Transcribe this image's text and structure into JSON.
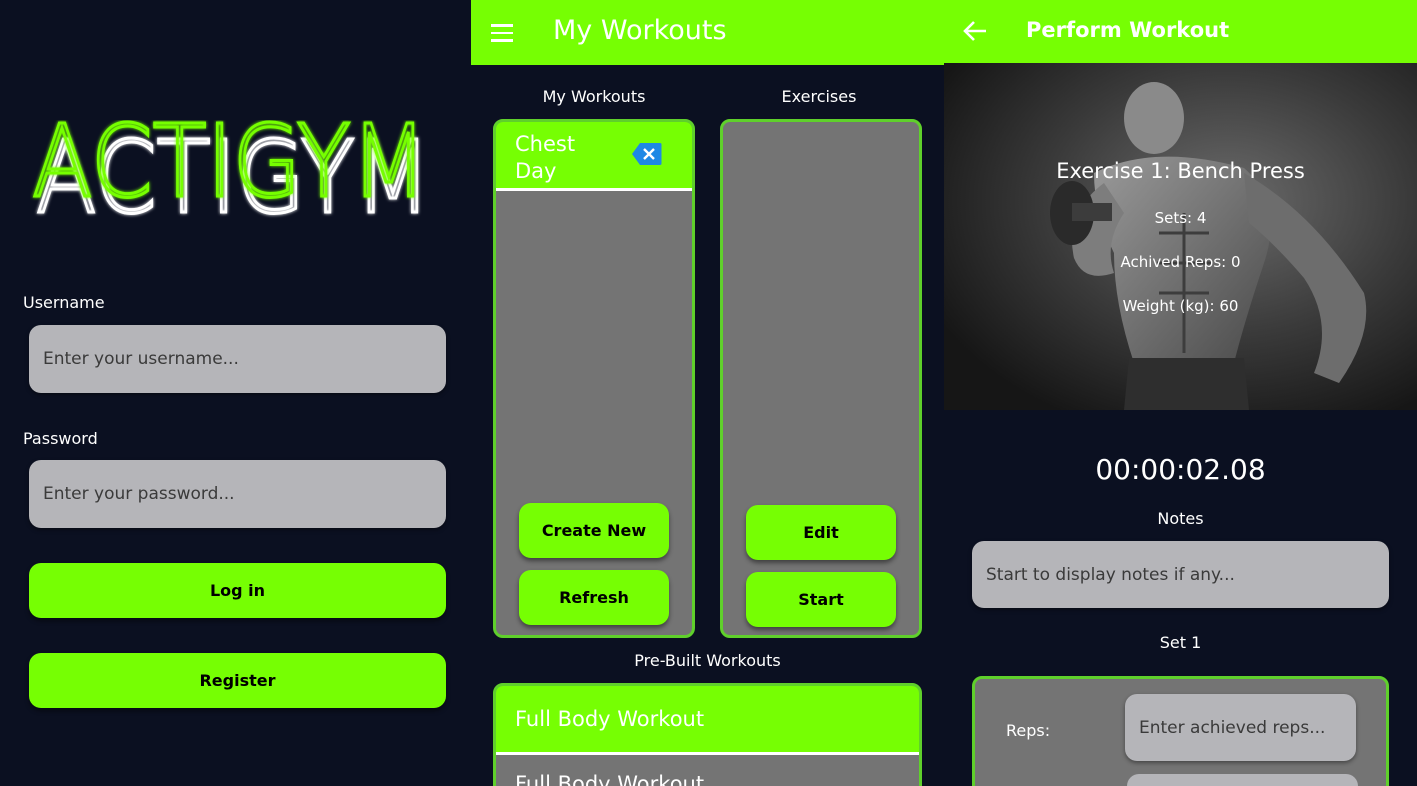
{
  "login": {
    "logo_text": "ACTIGYM",
    "username_label": "Username",
    "username_placeholder": "Enter your username...",
    "password_label": "Password",
    "password_placeholder": "Enter your password...",
    "login_button": "Log in",
    "register_button": "Register"
  },
  "workouts": {
    "title": "My Workouts",
    "my_workouts_label": "My Workouts",
    "exercises_label": "Exercises",
    "items": [
      {
        "name": "Chest\nDay"
      }
    ],
    "create_button": "Create New",
    "refresh_button": "Refresh",
    "edit_button": "Edit",
    "start_button": "Start",
    "prebuilt_label": "Pre-Built Workouts",
    "prebuilt": [
      {
        "name": "Full Body Workout"
      },
      {
        "name": "Full Body Workout"
      }
    ]
  },
  "perform": {
    "title": "Perform Workout",
    "exercise": "Exercise 1: Bench Press",
    "sets": "Sets: 4",
    "achieved_reps": "Achived Reps: 0",
    "weight": "Weight (kg): 60",
    "timer": "00:00:02.08",
    "notes_label": "Notes",
    "notes_placeholder": "Start to display notes if any...",
    "set_label": "Set 1",
    "reps_label": "Reps:",
    "reps_placeholder": "Enter achieved reps..."
  },
  "colors": {
    "accent": "#76ff03",
    "background": "#0b1021",
    "panel_gray": "#747474",
    "input_gray": "#b5b5b9",
    "delete_icon": "#1e88e5"
  },
  "icons": [
    "menu-icon",
    "back-arrow-icon",
    "delete-icon"
  ]
}
